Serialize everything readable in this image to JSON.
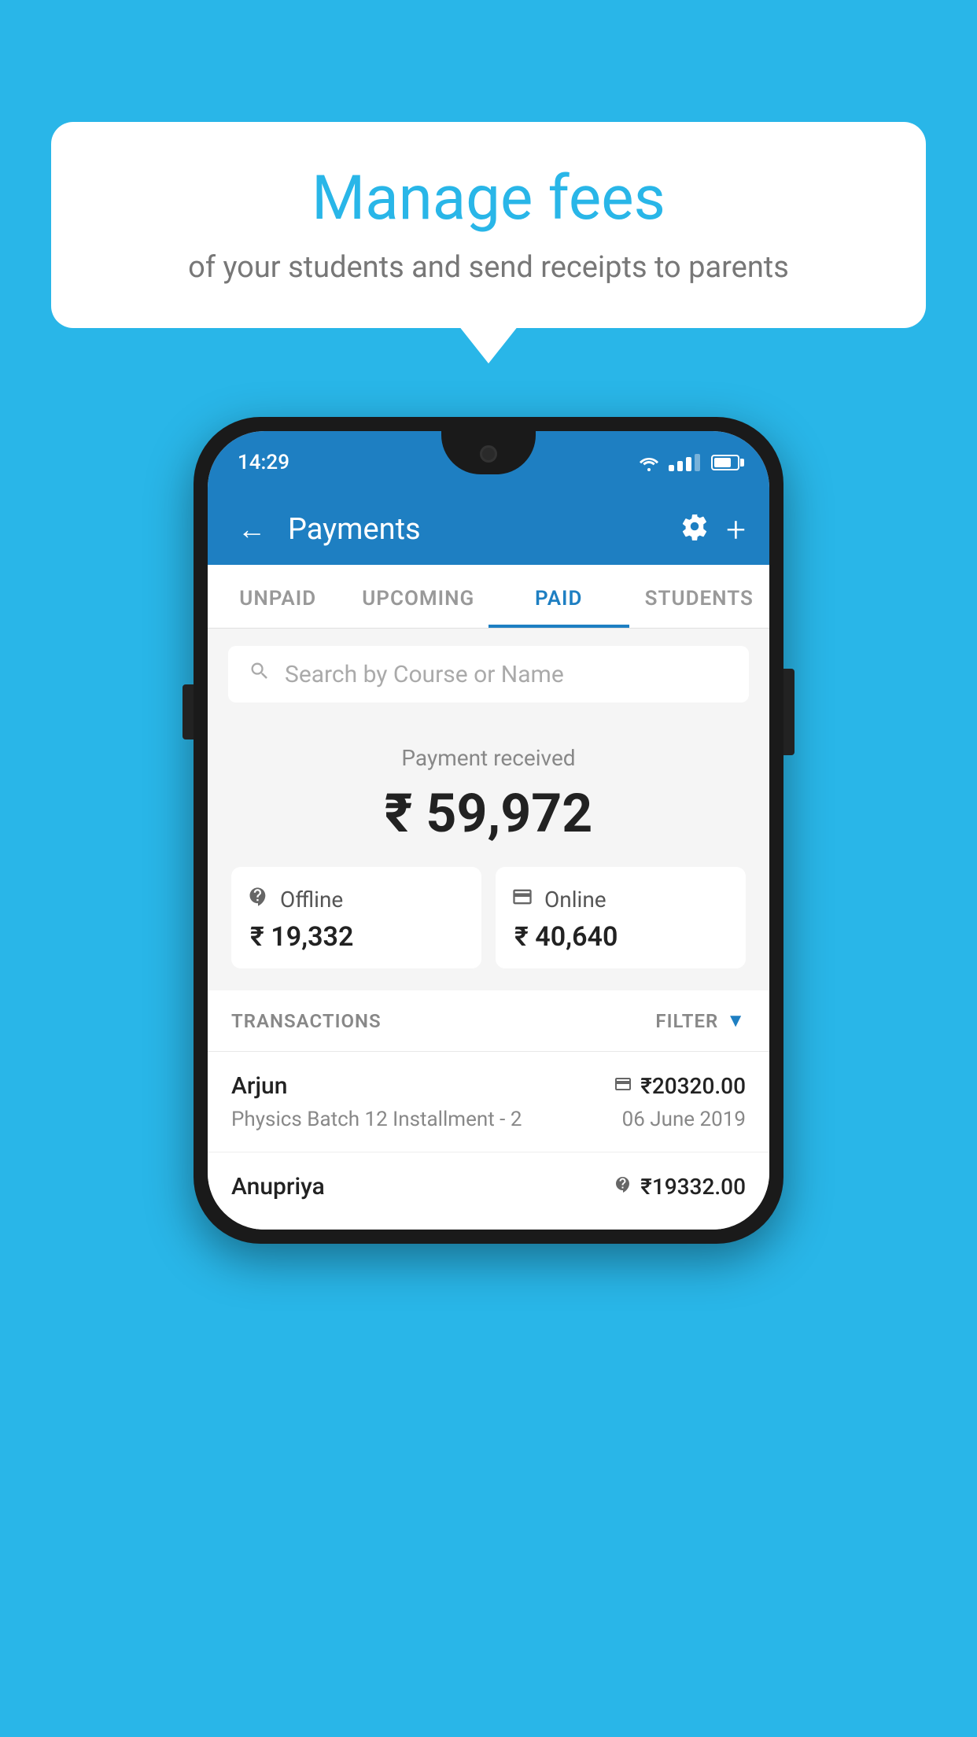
{
  "background_color": "#29b6e8",
  "speech_bubble": {
    "title": "Manage fees",
    "subtitle": "of your students and send receipts to parents"
  },
  "phone": {
    "status_bar": {
      "time": "14:29"
    },
    "header": {
      "title": "Payments",
      "back_label": "←",
      "settings_icon": "gear-icon",
      "add_icon": "plus-icon"
    },
    "tabs": [
      {
        "label": "UNPAID",
        "active": false
      },
      {
        "label": "UPCOMING",
        "active": false
      },
      {
        "label": "PAID",
        "active": true
      },
      {
        "label": "STUDENTS",
        "active": false
      }
    ],
    "search": {
      "placeholder": "Search by Course or Name"
    },
    "payment_summary": {
      "received_label": "Payment received",
      "amount": "₹ 59,972",
      "offline": {
        "label": "Offline",
        "amount": "₹ 19,332"
      },
      "online": {
        "label": "Online",
        "amount": "₹ 40,640"
      }
    },
    "transactions_section": {
      "header": "TRANSACTIONS",
      "filter_label": "FILTER",
      "items": [
        {
          "name": "Arjun",
          "amount": "₹20320.00",
          "course": "Physics Batch 12 Installment - 2",
          "date": "06 June 2019",
          "payment_type": "online"
        },
        {
          "name": "Anupriya",
          "amount": "₹19332.00",
          "course": "",
          "date": "",
          "payment_type": "offline"
        }
      ]
    }
  }
}
